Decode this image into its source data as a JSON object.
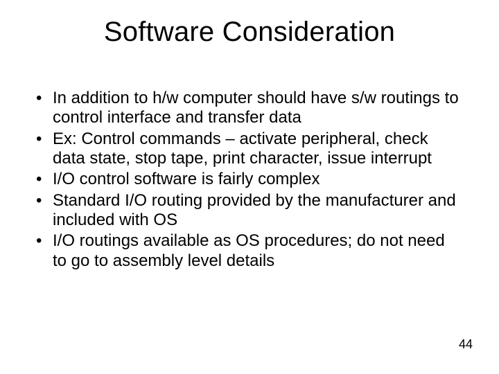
{
  "slide": {
    "title": "Software Consideration",
    "bullets": [
      "In addition to h/w computer should have s/w routings to control interface and transfer data",
      "Ex: Control commands – activate peripheral, check data state, stop tape, print character, issue interrupt",
      "I/O control software is fairly complex",
      "Standard I/O routing provided by the manufacturer and included with OS",
      "I/O routings available as OS procedures; do not need to go to assembly level details"
    ],
    "page_number": "44"
  }
}
